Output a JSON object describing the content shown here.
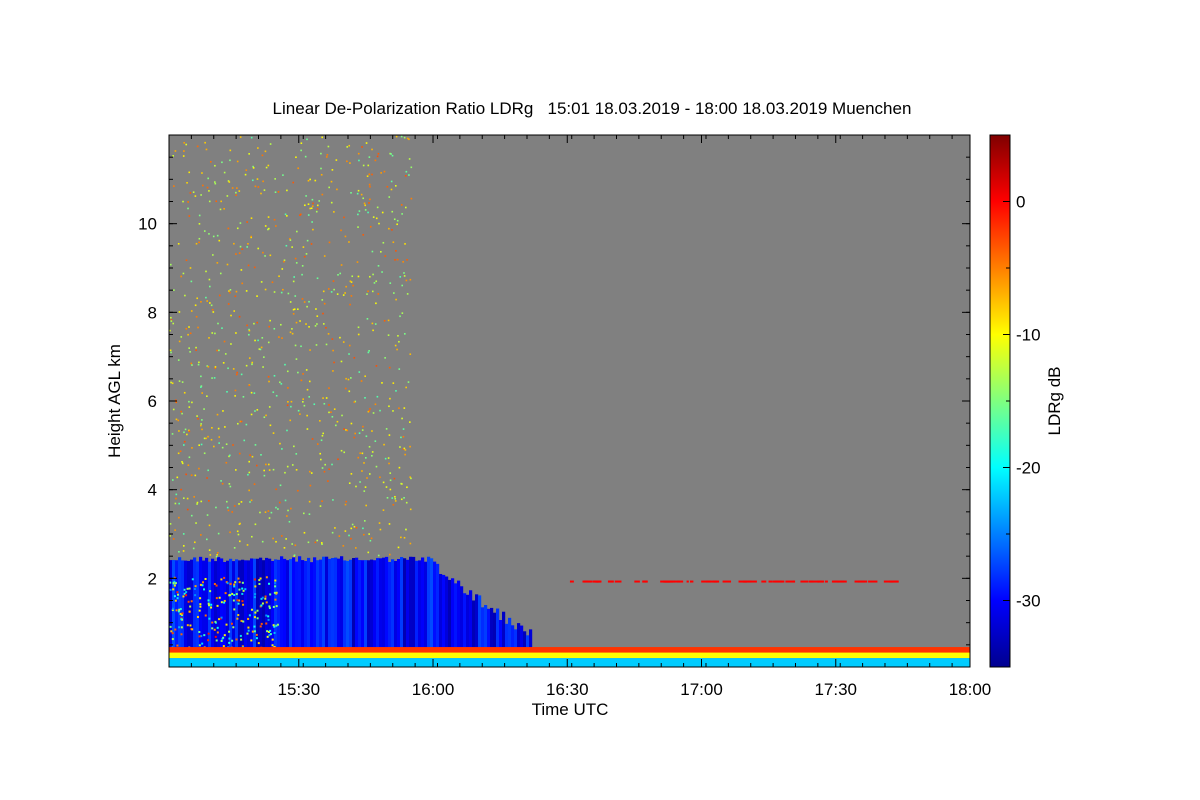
{
  "chart_data": {
    "type": "heatmap",
    "title": "Linear De-Polarization Ratio LDRg   15:01 18.03.2019 - 18:00 18.03.2019 Muenchen",
    "xlabel": "Time UTC",
    "ylabel": "Height AGL km",
    "colorbar_label": "LDRg dB",
    "x_range": [
      "15:01",
      "18:00"
    ],
    "x_ticks": [
      "15:30",
      "16:00",
      "16:30",
      "17:00",
      "17:30",
      "18:00"
    ],
    "y_range": [
      0,
      12
    ],
    "y_ticks": [
      2,
      4,
      6,
      8,
      10
    ],
    "colorbar_range": [
      -35,
      5
    ],
    "colorbar_ticks": [
      0,
      -10,
      -20,
      -30
    ],
    "colors": {
      "no_signal": "#808080",
      "low": "#00008f",
      "mid": "#00ffff",
      "high": "#800000"
    },
    "features": [
      {
        "name": "boundary layer depolarization (low LDR, blue)",
        "t_start": "15:01",
        "t_end": "16:22",
        "z_bottom": 0.25,
        "z_top": 2.5,
        "ldr_db": -30
      },
      {
        "name": "surface layer (high LDR, orange/red)",
        "t_start": "15:01",
        "t_end": "18:00",
        "z_bottom": 0.2,
        "z_top": 0.45,
        "ldr_db": -2
      },
      {
        "name": "elevated aerosol line",
        "t_start": "16:30",
        "t_end": "17:45",
        "z_bottom": 1.88,
        "z_top": 1.95,
        "ldr_db": 0
      },
      {
        "name": "scattered particles aloft",
        "t_start": "15:01",
        "t_end": "15:55",
        "z_bottom": 2.5,
        "z_top": 12,
        "ldr_db": -10
      }
    ]
  }
}
